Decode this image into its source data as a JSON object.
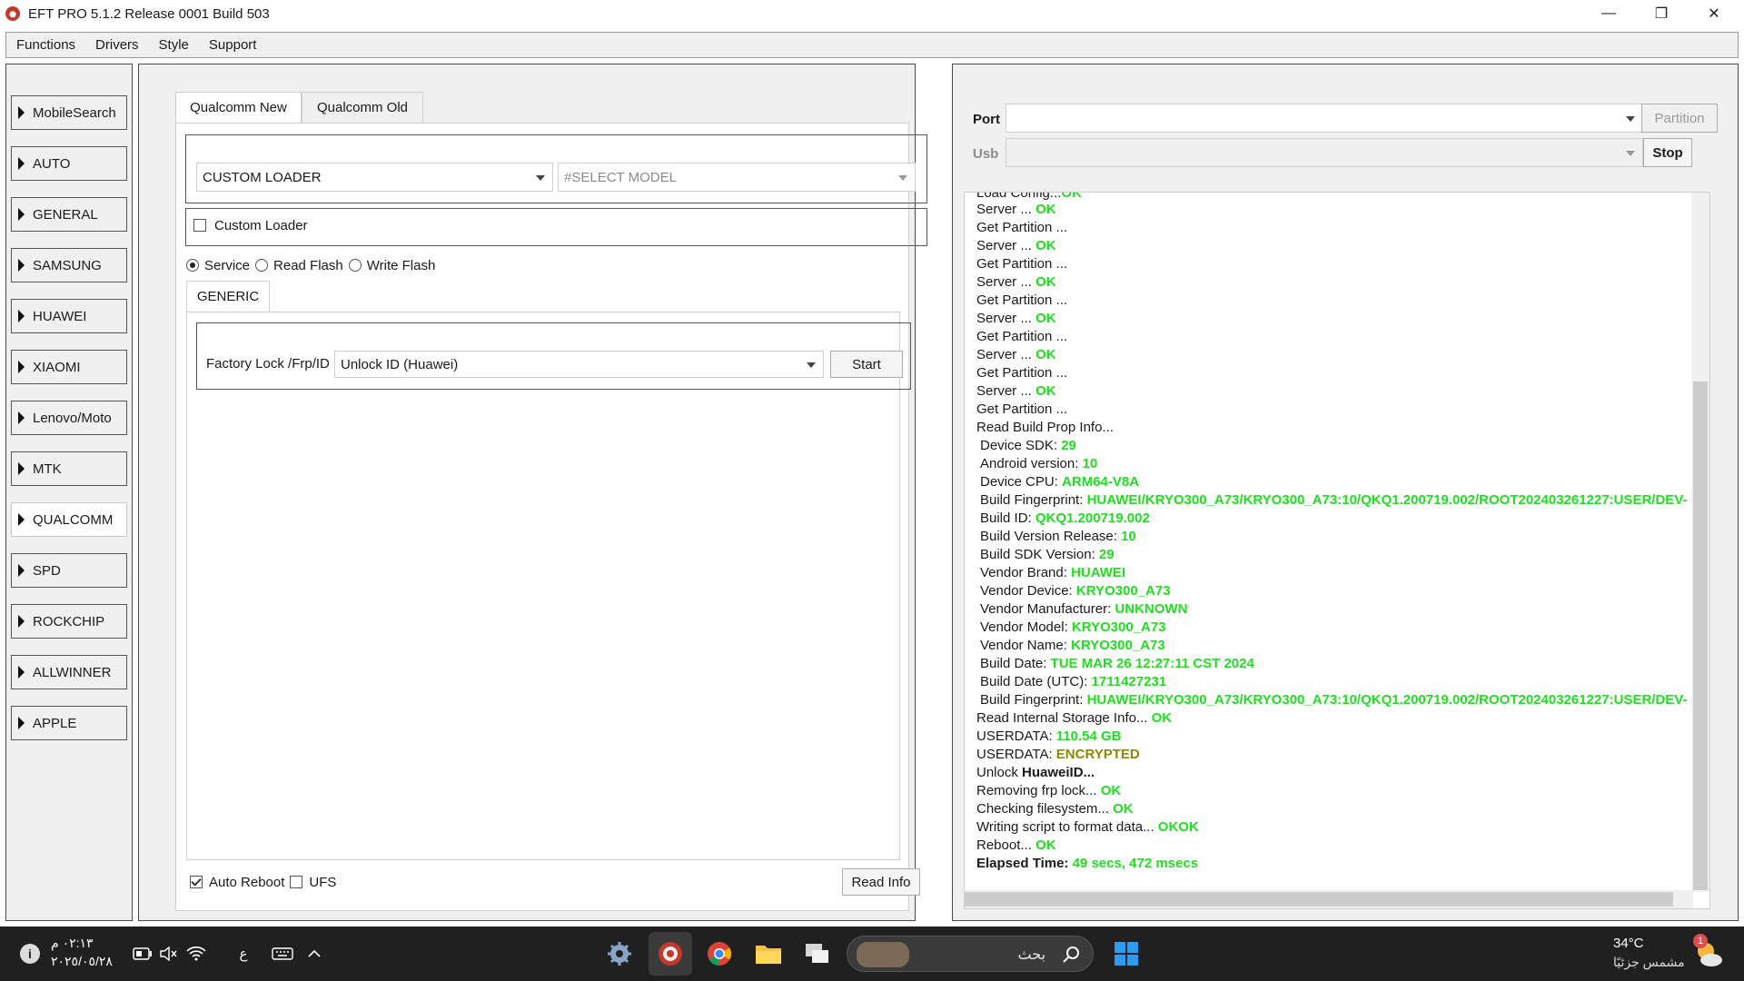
{
  "window": {
    "title": "EFT PRO 5.1.2 Release 0001 Build 503",
    "minimize_glyph": "—",
    "restore_glyph": "❐",
    "close_glyph": "✕"
  },
  "menu": [
    "Functions",
    "Drivers",
    "Style",
    "Support"
  ],
  "sidebar": {
    "items": [
      {
        "label": "MobileSearch",
        "selected": false
      },
      {
        "label": "AUTO",
        "selected": false
      },
      {
        "label": "GENERAL",
        "selected": false
      },
      {
        "label": "SAMSUNG",
        "selected": false
      },
      {
        "label": "HUAWEI",
        "selected": false
      },
      {
        "label": "XIAOMI",
        "selected": false
      },
      {
        "label": "Lenovo/Moto",
        "selected": false
      },
      {
        "label": "MTK",
        "selected": false
      },
      {
        "label": "QUALCOMM",
        "selected": true
      },
      {
        "label": "SPD",
        "selected": false
      },
      {
        "label": "ROCKCHIP",
        "selected": false
      },
      {
        "label": "ALLWINNER",
        "selected": false
      },
      {
        "label": "APPLE",
        "selected": false
      }
    ]
  },
  "main": {
    "tabs": [
      {
        "label": "Qualcomm New",
        "active": true
      },
      {
        "label": "Qualcomm Old",
        "active": false
      }
    ],
    "loader_select": "CUSTOM LOADER",
    "model_select": "#SELECT MODEL",
    "custom_loader_label": "Custom Loader",
    "custom_loader_checked": false,
    "modes": [
      {
        "label": "Service",
        "checked": true
      },
      {
        "label": "Read Flash",
        "checked": false
      },
      {
        "label": "Write Flash",
        "checked": false
      }
    ],
    "subtab": "GENERIC",
    "factory_label": "Factory Lock /Frp/ID",
    "factory_select": "Unlock ID (Huawei)",
    "start_button": "Start",
    "auto_reboot_label": "Auto Reboot",
    "auto_reboot_checked": true,
    "ufs_label": "UFS",
    "ufs_checked": false,
    "read_info_button": "Read Info"
  },
  "right": {
    "port_label": "Port",
    "port_value": "",
    "usb_label": "Usb",
    "usb_value": "",
    "partition_button": "Partition",
    "stop_button": "Stop"
  },
  "log": [
    {
      "text": "Load Config...",
      "val": "OK",
      "cls": "ok",
      "cut": true
    },
    {
      "text": "Server ... ",
      "val": "OK",
      "cls": "ok"
    },
    {
      "text": "Get Partition ...",
      "val": "",
      "cls": ""
    },
    {
      "text": "Server ... ",
      "val": "OK",
      "cls": "ok"
    },
    {
      "text": "Get Partition ...",
      "val": "",
      "cls": ""
    },
    {
      "text": "Server ... ",
      "val": "OK",
      "cls": "ok"
    },
    {
      "text": "Get Partition ...",
      "val": "",
      "cls": ""
    },
    {
      "text": "Server ... ",
      "val": "OK",
      "cls": "ok"
    },
    {
      "text": "Get Partition ...",
      "val": "",
      "cls": ""
    },
    {
      "text": "Server ... ",
      "val": "OK",
      "cls": "ok"
    },
    {
      "text": "Get Partition ...",
      "val": "",
      "cls": ""
    },
    {
      "text": "Server ... ",
      "val": "OK",
      "cls": "ok"
    },
    {
      "text": "Get Partition ...",
      "val": "",
      "cls": ""
    },
    {
      "text": "Read Build Prop Info...",
      "val": "",
      "cls": ""
    },
    {
      "text": "Device SDK: ",
      "val": "29",
      "cls": "ok",
      "indent": true
    },
    {
      "text": "Android version: ",
      "val": "10",
      "cls": "ok",
      "indent": true
    },
    {
      "text": "Device CPU: ",
      "val": "ARM64-V8A",
      "cls": "ok",
      "indent": true
    },
    {
      "text": "Build Fingerprint: ",
      "val": "HUAWEI/KRYO300_A73/KRYO300_A73:10/QKQ1.200719.002/ROOT202403261227:USER/DEV-",
      "cls": "ok",
      "indent": true
    },
    {
      "text": "Build ID: ",
      "val": "QKQ1.200719.002",
      "cls": "ok",
      "indent": true
    },
    {
      "text": "Build Version Release: ",
      "val": "10",
      "cls": "ok",
      "indent": true
    },
    {
      "text": "Build SDK Version: ",
      "val": "29",
      "cls": "ok",
      "indent": true
    },
    {
      "text": "Vendor Brand: ",
      "val": "HUAWEI",
      "cls": "ok",
      "indent": true
    },
    {
      "text": "Vendor Device: ",
      "val": "KRYO300_A73",
      "cls": "ok",
      "indent": true
    },
    {
      "text": "Vendor Manufacturer: ",
      "val": "UNKNOWN",
      "cls": "ok",
      "indent": true
    },
    {
      "text": "Vendor Model: ",
      "val": "KRYO300_A73",
      "cls": "ok",
      "indent": true
    },
    {
      "text": "Vendor Name: ",
      "val": "KRYO300_A73",
      "cls": "ok",
      "indent": true
    },
    {
      "text": "Build Date: ",
      "val": "TUE MAR 26 12:27:11 CST 2024",
      "cls": "ok",
      "indent": true
    },
    {
      "text": "Build Date (UTC): ",
      "val": "1711427231",
      "cls": "ok",
      "indent": true
    },
    {
      "text": "Build Fingerprint: ",
      "val": "HUAWEI/KRYO300_A73/KRYO300_A73:10/QKQ1.200719.002/ROOT202403261227:USER/DEV-",
      "cls": "ok",
      "indent": true
    },
    {
      "text": "Read Internal Storage Info... ",
      "val": "OK",
      "cls": "ok"
    },
    {
      "text": "USERDATA: ",
      "val": "110.54 GB",
      "cls": "ok"
    },
    {
      "text": "USERDATA: ",
      "val": "ENCRYPTED",
      "cls": "warn"
    },
    {
      "text": "Unlock ",
      "val": "HuaweiID...",
      "cls": "strong"
    },
    {
      "text": "Removing frp lock... ",
      "val": "OK",
      "cls": "ok"
    },
    {
      "text": "Checking filesystem... ",
      "val": "OK",
      "cls": "ok"
    },
    {
      "text": "Writing script to format data... ",
      "val": "OKOK",
      "cls": "ok"
    },
    {
      "text": "Reboot... ",
      "val": "OK",
      "cls": "ok"
    },
    {
      "text": "Elapsed Time: ",
      "val": "49 secs, 472 msecs",
      "cls": "ok",
      "boldlabel": true
    }
  ],
  "taskbar": {
    "time": "٠٢:١٣ م",
    "date": "٢٠٢٥/٠٥/٢٨",
    "lang": "ع",
    "search_placeholder": "بحث",
    "weather_temp": "34°C",
    "weather_desc": "مشمس جزئيًا",
    "notification_count": "1",
    "info_glyph": "i"
  },
  "colors": {
    "ok": "#22dd22",
    "warn": "#8a8a00",
    "panel_bg": "#f0f0f0",
    "taskbar_bg": "#202020"
  }
}
